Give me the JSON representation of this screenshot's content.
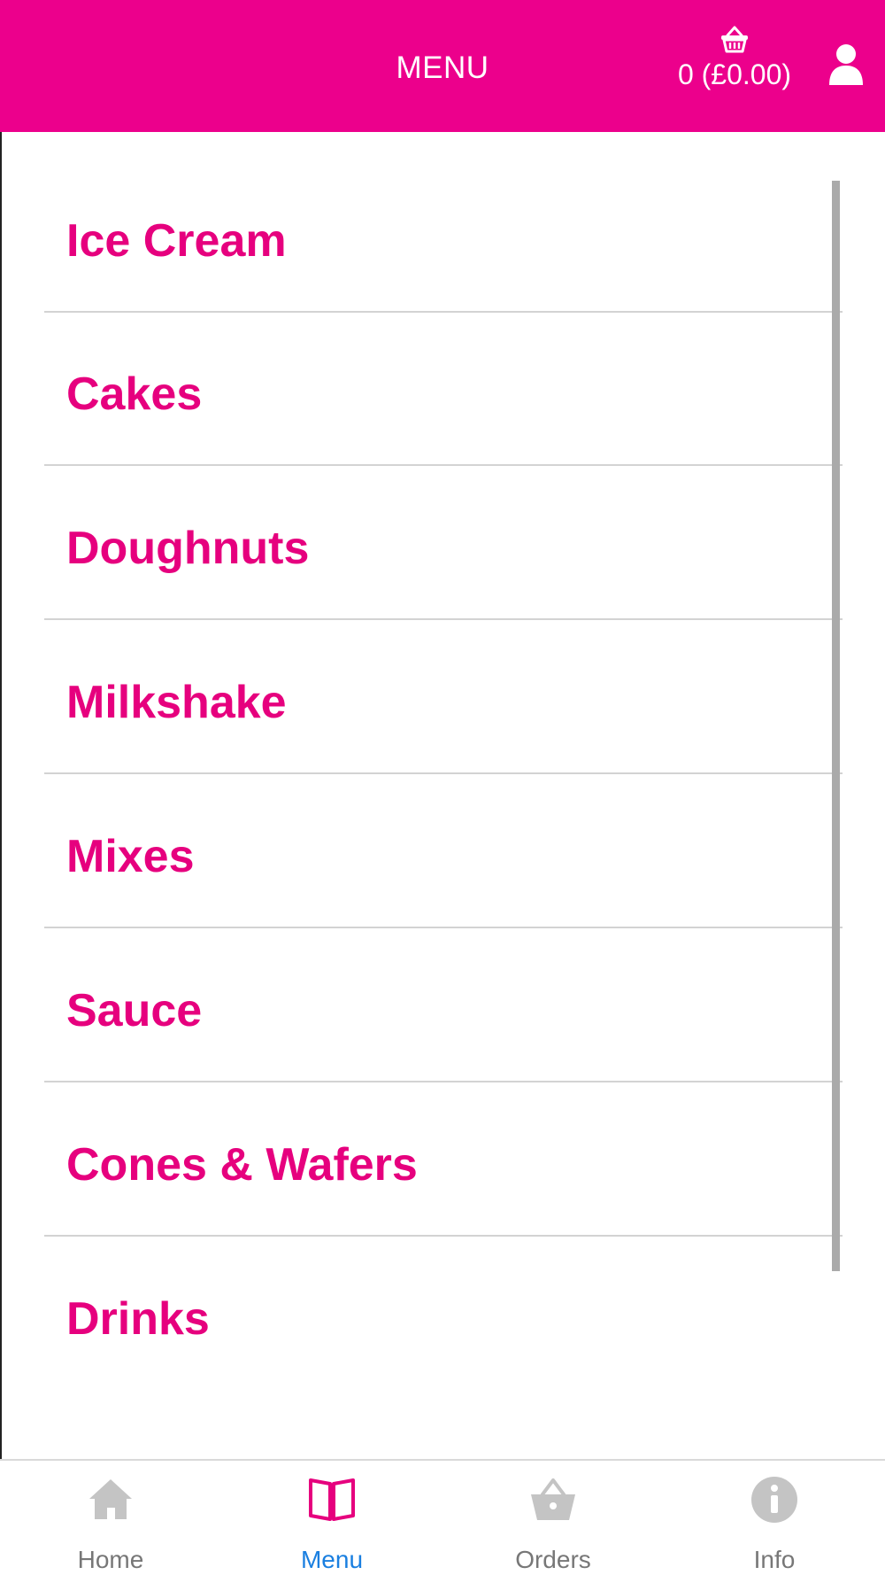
{
  "header": {
    "title": "MENU",
    "cart_count": "0 (£0.00)",
    "cart_icon": "basket-icon",
    "user_icon": "user-icon"
  },
  "categories": [
    {
      "label": "Ice Cream"
    },
    {
      "label": "Cakes"
    },
    {
      "label": "Doughnuts"
    },
    {
      "label": "Milkshake"
    },
    {
      "label": "Mixes"
    },
    {
      "label": "Sauce"
    },
    {
      "label": "Cones & Wafers"
    },
    {
      "label": "Drinks"
    }
  ],
  "bottom_nav": {
    "items": [
      {
        "label": "Home",
        "icon": "home-icon",
        "active": false
      },
      {
        "label": "Menu",
        "icon": "book-icon",
        "active": true
      },
      {
        "label": "Orders",
        "icon": "basket-icon",
        "active": false
      },
      {
        "label": "Info",
        "icon": "info-icon",
        "active": false
      }
    ]
  },
  "colors": {
    "brand": "#ec008c",
    "category_text": "#e6007e",
    "nav_active": "#1a7fe0",
    "nav_inactive": "#777777"
  }
}
